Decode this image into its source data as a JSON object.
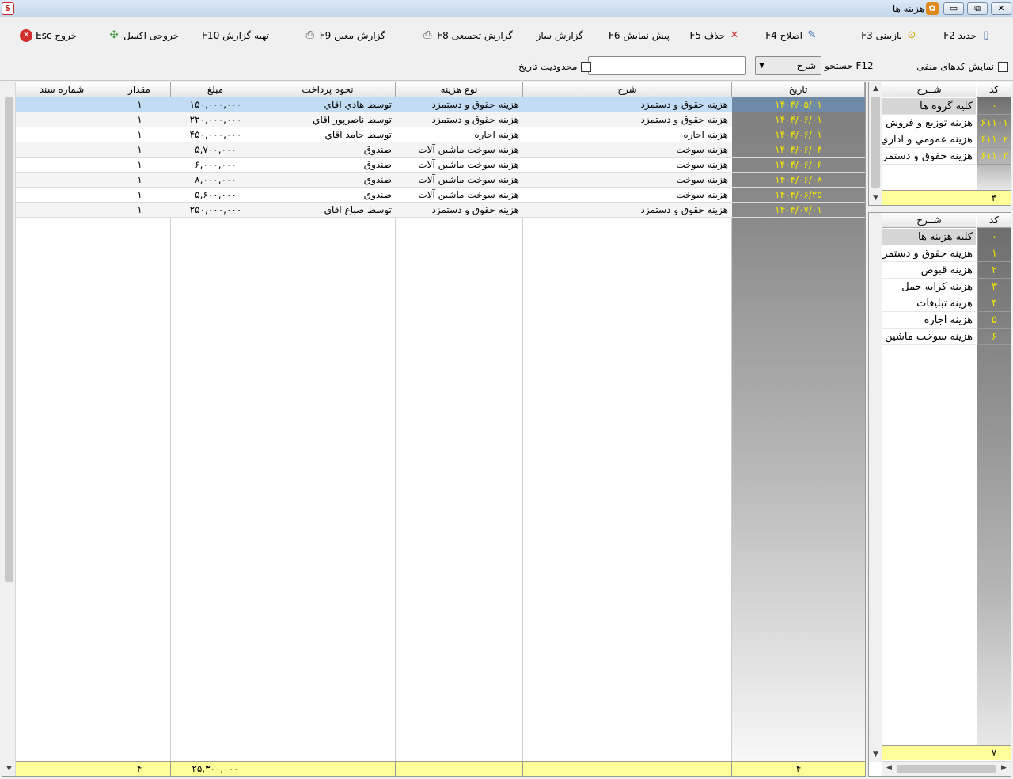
{
  "window": {
    "title": "هزینه ها",
    "app_icon": "app-logo-icon",
    "controls": {
      "minimize": "▭",
      "restore": "⧉",
      "close": "✕"
    }
  },
  "toolbar": {
    "new_label": "جدید F2",
    "view_label": "بازبینی F3",
    "edit_label": "اصلاح F4",
    "delete_label": "حذف F5",
    "preview_label": "پیش نمایش F6",
    "report_builder_label": "گزارش ساز",
    "summary_report_label": "گزارش تجمیعی F8",
    "specific_report_label": "گزارش معین F9",
    "prepare_report_label": "تهیه گزارش F10",
    "excel_label": "خروجی اکسل",
    "exit_label": "خروج Esc"
  },
  "filters": {
    "show_negative_codes_label": "نمایش کدهای منفی",
    "search_label": "F12 جستجو",
    "search_field_value": "شرح",
    "search_value": "",
    "date_limit_label": "محدودیت تاریخ"
  },
  "grid": {
    "columns": {
      "date": "تاریخ",
      "description": "شرح",
      "expense_type": "نوع هزینه",
      "payment_method": "نحوه پرداخت",
      "amount": "مبلغ",
      "quantity": "مقدار",
      "doc_number": "شماره سند"
    },
    "rows": [
      {
        "date": "۱۴۰۴/۰۵/۰۱",
        "description": "هزینه حقوق و دستمزد",
        "expense_type": "هزینه حقوق و دستمزد",
        "payment_method": "توسط هادي اقاي",
        "amount": "۱۵۰,۰۰۰,۰۰۰",
        "quantity": "۱",
        "doc_number": ""
      },
      {
        "date": "۱۴۰۴/۰۶/۰۱",
        "description": "هزینه حقوق و دستمزد",
        "expense_type": "هزینه حقوق و دستمزد",
        "payment_method": "توسط ناصرپور اقاي",
        "amount": "۲۲۰,۰۰۰,۰۰۰",
        "quantity": "۱",
        "doc_number": ""
      },
      {
        "date": "۱۴۰۴/۰۶/۰۱",
        "description": "هزینه اجاره",
        "expense_type": "هزینه اجاره",
        "payment_method": "توسط حامد اقاي",
        "amount": "۴۵۰,۰۰۰,۰۰۰",
        "quantity": "۱",
        "doc_number": ""
      },
      {
        "date": "۱۴۰۴/۰۶/۰۴",
        "description": "هزینه سوخت",
        "expense_type": "هزینه سوخت ماشین آلات",
        "payment_method": "صندوق",
        "amount": "۵,۷۰۰,۰۰۰",
        "quantity": "۱",
        "doc_number": ""
      },
      {
        "date": "۱۴۰۴/۰۶/۰۶",
        "description": "هزینه سوخت",
        "expense_type": "هزینه سوخت ماشین آلات",
        "payment_method": "صندوق",
        "amount": "۶,۰۰۰,۰۰۰",
        "quantity": "۱",
        "doc_number": ""
      },
      {
        "date": "۱۴۰۴/۰۶/۰۸",
        "description": "هزینه سوخت",
        "expense_type": "هزینه سوخت ماشین آلات",
        "payment_method": "صندوق",
        "amount": "۸,۰۰۰,۰۰۰",
        "quantity": "۱",
        "doc_number": ""
      },
      {
        "date": "۱۴۰۴/۰۶/۲۵",
        "description": "هزینه سوخت",
        "expense_type": "هزینه سوخت ماشین آلات",
        "payment_method": "صندوق",
        "amount": "۵,۶۰۰,۰۰۰",
        "quantity": "۱",
        "doc_number": ""
      },
      {
        "date": "۱۴۰۴/۰۷/۰۱",
        "description": "هزینه حقوق و دستمزد",
        "expense_type": "هزینه حقوق و دستمزد",
        "payment_method": "توسط صباغ اقاي",
        "amount": "۲۵۰,۰۰۰,۰۰۰",
        "quantity": "۱",
        "doc_number": ""
      }
    ],
    "footer": {
      "date_count": "۴",
      "amount_total": "۲۵,۳۰۰,۰۰۰",
      "quantity_total": "۴"
    }
  },
  "group_panel": {
    "code_header": "کد",
    "desc_header": "شــرح",
    "items": [
      {
        "code": "۰",
        "label": "کلیه گروه ها"
      },
      {
        "code": "۶۱۱۰۱",
        "label": "هزینه توزیع و فروش"
      },
      {
        "code": "۶۱۱۰۲",
        "label": "هزینه عمومي و اداري"
      },
      {
        "code": "۶۱۱۰۳",
        "label": "هزینه حقوق و دستمزد"
      }
    ],
    "footer_count": "۴"
  },
  "category_panel": {
    "code_header": "کد",
    "desc_header": "شــرح",
    "items": [
      {
        "code": "۰",
        "label": "کلیه هزینه ها"
      },
      {
        "code": "۱",
        "label": "هزینه حقوق و دستمزد"
      },
      {
        "code": "۲",
        "label": "هزینه قبوض"
      },
      {
        "code": "۳",
        "label": "هزینه کرایه حمل"
      },
      {
        "code": "۴",
        "label": "هزینه تبلیغات"
      },
      {
        "code": "۵",
        "label": "هزینه اجاره"
      },
      {
        "code": "۶",
        "label": "هزینه سوخت ماشین آلات"
      }
    ],
    "footer_count": "۷"
  },
  "colors": {
    "selected_row": "#c2dcf4",
    "date_text": "#f5e600",
    "footer_bg": "#ffff99"
  }
}
